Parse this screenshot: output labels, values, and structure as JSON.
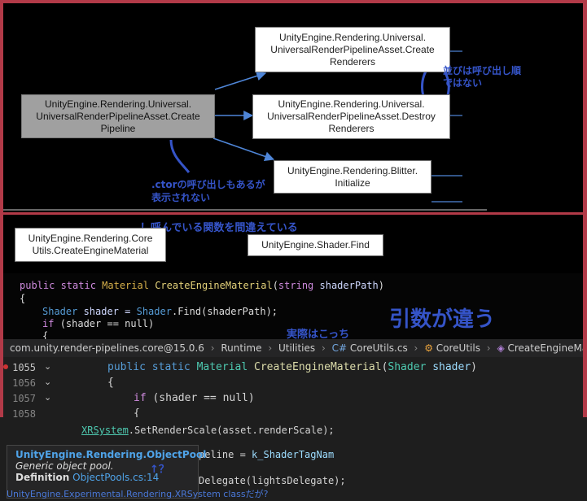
{
  "graph": {
    "nodes": [
      {
        "id": "create-pipeline",
        "label": "UnityEngine.Rendering.Universal.\nUniversalRenderPipelineAsset.Create\nPipeline"
      },
      {
        "id": "create-renderers",
        "label": "UnityEngine.Rendering.Universal.\nUniversalRenderPipelineAsset.Create\nRenderers"
      },
      {
        "id": "destroy-renderers",
        "label": "UnityEngine.Rendering.Universal.\nUniversalRenderPipelineAsset.Destroy\nRenderers"
      },
      {
        "id": "blitter-initialize",
        "label": "UnityEngine.Rendering.Blitter.\nInitialize"
      },
      {
        "id": "create-engine-material",
        "label": "UnityEngine.Rendering.Core\nUtils.CreateEngineMaterial"
      },
      {
        "id": "shader-find",
        "label": "UnityEngine.Shader.Find"
      }
    ]
  },
  "annotations": {
    "order": "並びは呼び出し順\nではない",
    "ctor": ".ctorの呼び出しもあるが\n表示されない",
    "wrong_function": "！呼んでいる関数を間違えている",
    "actual": "実際はこっち",
    "args_differ": "引数が違う",
    "question": "↑？"
  },
  "code_snippet": {
    "line1": {
      "kw": "public static ",
      "ty": "Material ",
      "fn": "CreateEngineMaterial",
      "p1": "(",
      "kw2": "string ",
      "id": "shaderPath",
      "p2": ")"
    },
    "line2": "{",
    "line3": {
      "ty": "Shader ",
      "id": "shader = ",
      "ty2": "Shader",
      "rest": ".Find(shaderPath);"
    },
    "line4": {
      "kw": "if ",
      "rest": "(shader == null)"
    },
    "line5": "{"
  },
  "breadcrumb": {
    "package": "com.unity.render-pipelines.core@15.0.6",
    "folder1": "Runtime",
    "folder2": "Utilities",
    "file": "CoreUtils.cs",
    "class": "CoreUtils",
    "member": "CreateEngineMaterial"
  },
  "editor": {
    "lines": [
      {
        "num": "1055",
        "kw": "public static ",
        "ty": "Material ",
        "fn": "CreateEngineMaterial",
        "p1": "(",
        "ty2": "Shader ",
        "pr": "shader",
        "p2": ")"
      },
      {
        "num": "1056",
        "text": "{"
      },
      {
        "num": "1057",
        "kw": "if ",
        "rest": "(shader == null)"
      },
      {
        "num": "1058",
        "text": "{"
      }
    ]
  },
  "lower_code": {
    "line1": {
      "link": "XRSystem",
      "rest": ".SetRenderScale(asset.renderScale);"
    },
    "line2": {
      "rest1": "peline = ",
      "fn": "k_ShaderTagNam"
    },
    "line3": {
      "rest": "Delegate(lightsDelegate);"
    },
    "status": "UnityEngine.Experimental.Rendering.XRSystem classだが?"
  },
  "tooltip": {
    "title": "UnityEngine.Rendering.ObjectPool",
    "desc": "Generic object pool.",
    "def_label": "Definition",
    "def_link": "ObjectPools.cs:14"
  }
}
